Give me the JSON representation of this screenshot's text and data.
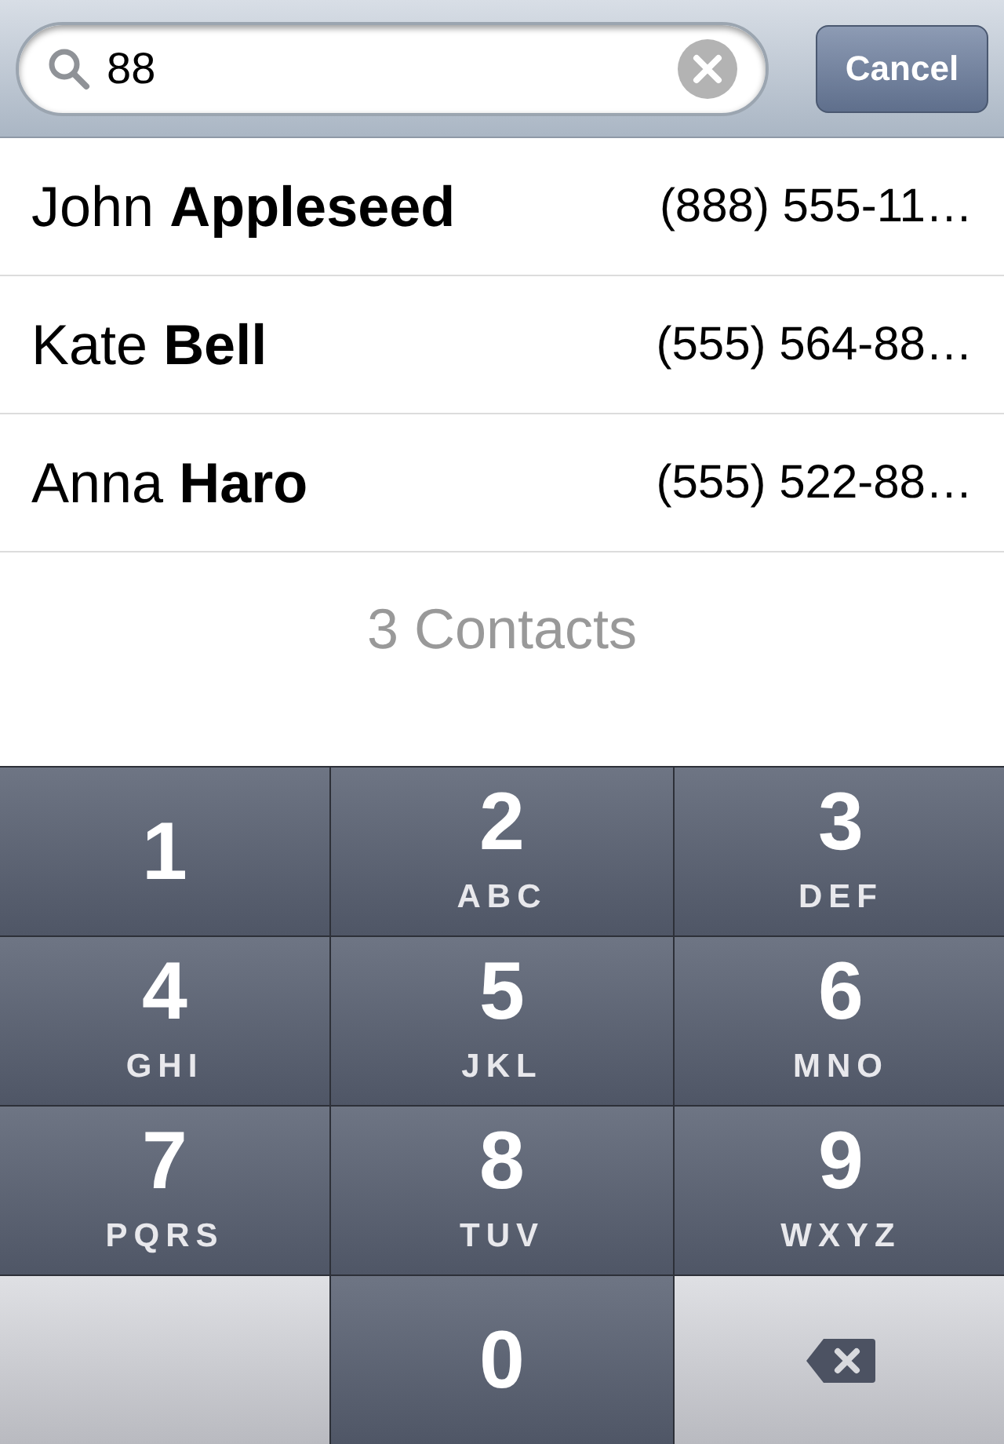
{
  "search": {
    "value": "88",
    "cancel": "Cancel"
  },
  "contacts": [
    {
      "name": "John **Appleseed**",
      "phone": "(888) 555-11…"
    },
    {
      "name": "Kate **Bell**",
      "phone": "(555) 564-88…"
    },
    {
      "name": "Anna **Haro**",
      "phone": "(555) 522-88…"
    }
  ],
  "footer": "3 Contacts",
  "keypad": [
    {
      "kind": "digit",
      "digit": "1"
    },
    {
      "kind": "digit",
      "digit": "2",
      "letters": "ABC"
    },
    {
      "kind": "digit",
      "digit": "3",
      "letters": "DEF"
    },
    {
      "kind": "digit",
      "digit": "4",
      "letters": "GHI"
    },
    {
      "kind": "digit",
      "digit": "5",
      "letters": "JKL"
    },
    {
      "kind": "digit",
      "digit": "6",
      "letters": "MNO"
    },
    {
      "kind": "digit",
      "digit": "7",
      "letters": "PQRS"
    },
    {
      "kind": "digit",
      "digit": "8",
      "letters": "TUV"
    },
    {
      "kind": "digit",
      "digit": "9",
      "letters": "WXYZ"
    },
    {
      "kind": "blank"
    },
    {
      "kind": "digit",
      "digit": "0"
    },
    {
      "kind": "delete"
    }
  ]
}
